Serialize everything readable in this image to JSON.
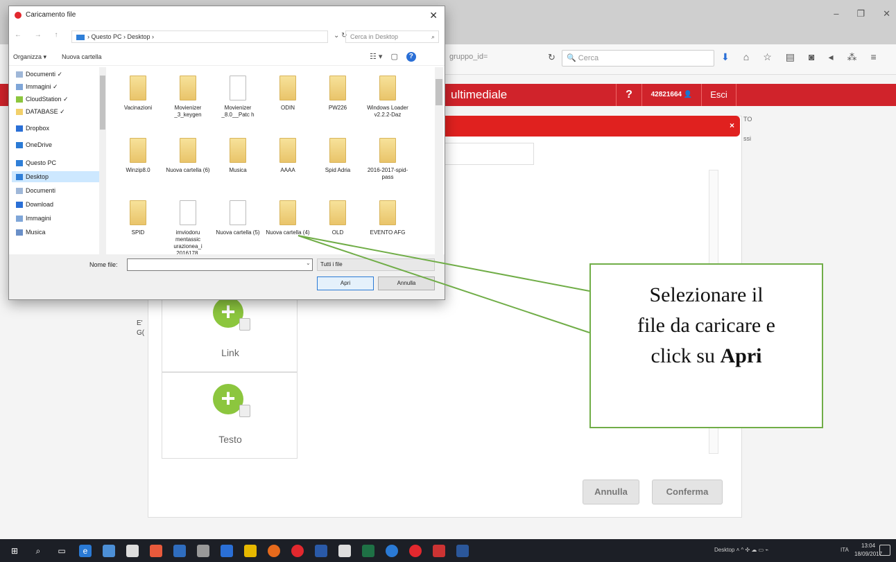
{
  "browser": {
    "url_tail": "gruppo_id=",
    "search_placeholder": "Cerca",
    "window_controls": [
      "–",
      "❐",
      "✕"
    ]
  },
  "app": {
    "title": "ultimediale",
    "help": "?",
    "user_id": "42821664",
    "logout": "Esci",
    "side_text": [
      "TO",
      "ssi"
    ]
  },
  "modal": {
    "close": "×",
    "cards": [
      {
        "label": "Link",
        "icon": "plus-link-icon"
      },
      {
        "label": "Testo",
        "icon": "plus-text-icon"
      }
    ],
    "side_letters": [
      "E'",
      "G("
    ],
    "buttons": {
      "cancel": "Annulla",
      "confirm": "Conferma"
    }
  },
  "dialog": {
    "title": "Caricamento file",
    "close": "✕",
    "nav_arrows": "← → ↑",
    "breadcrumb": "› Questo PC › Desktop ›",
    "refresh": "⌄ ↻",
    "search_placeholder": "Cerca in Desktop",
    "organize": "Organizza ▾",
    "new_folder": "Nuova cartella",
    "view_icons": [
      "☷ ▾",
      "▢"
    ],
    "help": "?",
    "nav_items": [
      {
        "label": "Documenti ✓",
        "color": "#9fb7d8"
      },
      {
        "label": "Immagini ✓",
        "color": "#7fa6d8"
      },
      {
        "label": "CloudStation ✓",
        "color": "#8cc63e"
      },
      {
        "label": "DATABASE ✓",
        "color": "#f2d06b"
      },
      {
        "label": "Dropbox",
        "color": "#2a6fd6"
      },
      {
        "label": "OneDrive",
        "color": "#2a7ad5"
      },
      {
        "label": "Questo PC",
        "color": "#2f7fd8"
      },
      {
        "label": "Desktop",
        "color": "#2f7fd8"
      },
      {
        "label": "Documenti",
        "color": "#9fb7d8"
      },
      {
        "label": "Download",
        "color": "#2a6fd6"
      },
      {
        "label": "Immagini",
        "color": "#7fa6d8"
      },
      {
        "label": "Musica",
        "color": "#6a8fc8"
      }
    ],
    "files": [
      {
        "name": "Vacinazioni",
        "kind": "folder"
      },
      {
        "name": "Movienizer _3_keygen",
        "kind": "folder"
      },
      {
        "name": "Movienizer _8.0__Patc h",
        "kind": "doc"
      },
      {
        "name": "ODIN",
        "kind": "folder"
      },
      {
        "name": "PW226",
        "kind": "folder"
      },
      {
        "name": "Windows Loader v2.2.2-Daz",
        "kind": "folder"
      },
      {
        "name": "Winzip8.0",
        "kind": "folder"
      },
      {
        "name": "Nuova cartella (6)",
        "kind": "folder"
      },
      {
        "name": "Musica",
        "kind": "folder"
      },
      {
        "name": "AAAA",
        "kind": "folder"
      },
      {
        "name": "Spid Adria",
        "kind": "folder"
      },
      {
        "name": "2016-2017-spid-pass",
        "kind": "folder"
      },
      {
        "name": "SPID",
        "kind": "folder"
      },
      {
        "name": "imviodoru mentassic urazionea_i _2016178...",
        "kind": "doc"
      },
      {
        "name": "Nuova cartella (5)",
        "kind": "doc"
      },
      {
        "name": "Nuova cartella (4)",
        "kind": "folder"
      },
      {
        "name": "OLD",
        "kind": "folder"
      },
      {
        "name": "EVENTO AFG",
        "kind": "folder"
      }
    ],
    "filename_label": "Nome file:",
    "filename_value": "",
    "filter": "Tutti i file",
    "open_button": "Apri",
    "cancel_button": "Annulla"
  },
  "callout": {
    "line1": "Selezionare il",
    "line2": "file da caricare e",
    "line3_prefix": "click su ",
    "line3_bold": "Apri",
    "color": "#70ad47"
  },
  "taskbar": {
    "tray_text": "Desktop ˄  ^ ✣ ☁ ▭ ⌁",
    "lang": "ITA",
    "time": "13:04",
    "date": "18/09/2017"
  }
}
